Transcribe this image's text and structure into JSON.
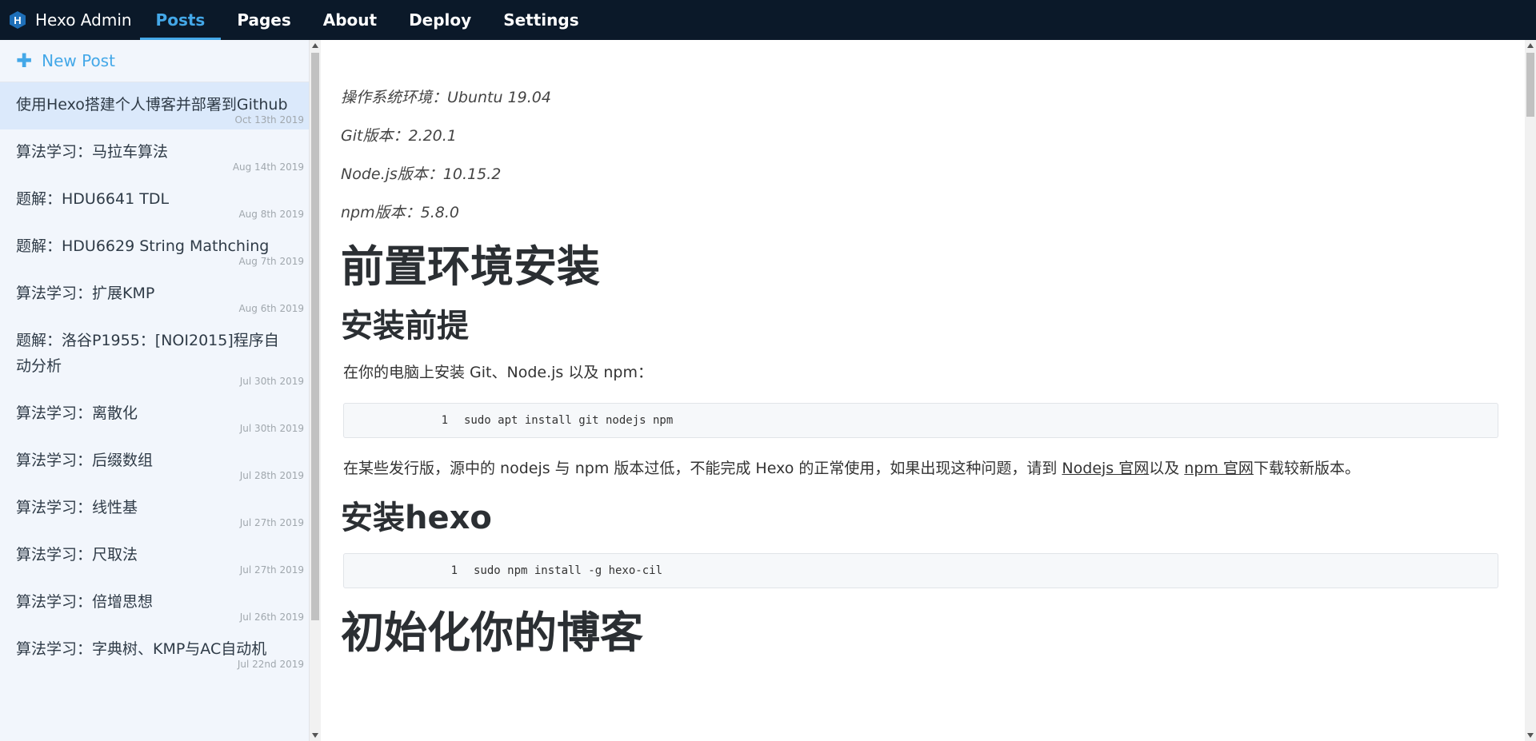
{
  "header": {
    "brand": "Hexo Admin",
    "logo_letter": "H",
    "tabs": [
      {
        "label": "Posts",
        "active": true
      },
      {
        "label": "Pages",
        "active": false
      },
      {
        "label": "About",
        "active": false
      },
      {
        "label": "Deploy",
        "active": false
      },
      {
        "label": "Settings",
        "active": false
      }
    ]
  },
  "sidebar": {
    "new_post_label": "New Post",
    "posts": [
      {
        "title": "使用Hexo搭建个人博客并部署到Github",
        "date": "Oct 13th 2019",
        "selected": true
      },
      {
        "title": "算法学习：马拉车算法",
        "date": "Aug 14th 2019"
      },
      {
        "title": "题解：HDU6641 TDL",
        "date": "Aug 8th 2019"
      },
      {
        "title": "题解：HDU6629 String Mathching",
        "date": "Aug 7th 2019"
      },
      {
        "title": "算法学习：扩展KMP",
        "date": "Aug 6th 2019"
      },
      {
        "title": "题解：洛谷P1955：[NOI2015]程序自动分析",
        "date": "Jul 30th 2019"
      },
      {
        "title": "算法学习：离散化",
        "date": "Jul 30th 2019"
      },
      {
        "title": "算法学习：后缀数组",
        "date": "Jul 28th 2019"
      },
      {
        "title": "算法学习：线性基",
        "date": "Jul 27th 2019"
      },
      {
        "title": "算法学习：尺取法",
        "date": "Jul 27th 2019"
      },
      {
        "title": "算法学习：倍增思想",
        "date": "Jul 26th 2019"
      },
      {
        "title": "算法学习：字典树、KMP与AC自动机",
        "date": "Jul 22nd 2019"
      }
    ]
  },
  "content": {
    "meta": [
      "操作系统环境：Ubuntu 19.04",
      "Git版本：2.20.1",
      "Node.js版本：10.15.2",
      "npm版本：5.8.0"
    ],
    "h1_env": "前置环境安装",
    "h2_prereq": "安装前提",
    "para_prereq": "在你的电脑上安装 Git、Node.js 以及 npm：",
    "code1": {
      "line": "1",
      "text": "sudo apt install git nodejs npm"
    },
    "para_note_pre": "在某些发行版，源中的 nodejs 与 npm 版本过低，不能完成 Hexo 的正常使用，如果出现这种问题，请到 ",
    "link_nodejs": "Nodejs 官网",
    "para_note_mid": "以及 ",
    "link_npm": "npm 官网",
    "para_note_post": "下载较新版本。",
    "h2_hexo": "安装hexo",
    "code2": {
      "line": "1",
      "text": "sudo npm install -g hexo-cil"
    },
    "h1_init": "初始化你的博客"
  },
  "colors": {
    "topbar": "#0b1929",
    "accent": "#44a8e8",
    "sidebar_bg": "#f2f6fc",
    "selected_bg": "#dbe9fb"
  }
}
